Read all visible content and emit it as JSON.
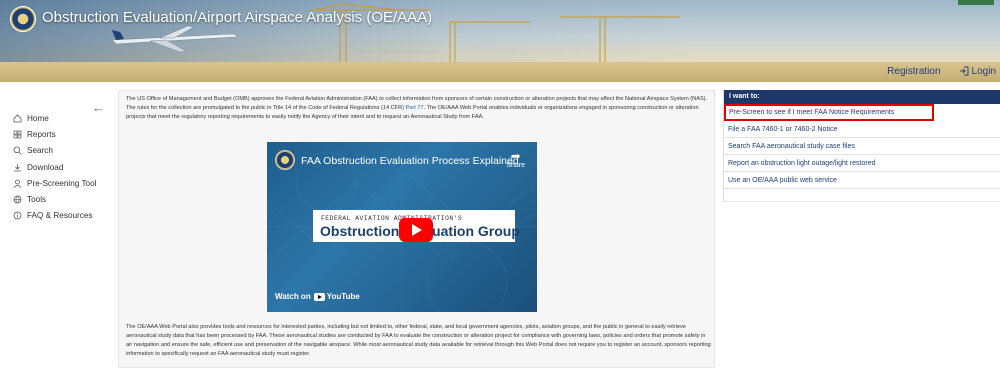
{
  "header": {
    "title": "Obstruction Evaluation/Airport Airspace Analysis (OE/AAA)",
    "links": {
      "registration": "Registration",
      "login": "Login"
    },
    "icons": {
      "seal": "faa-seal-icon",
      "login": "login-icon"
    }
  },
  "sidebar": {
    "items": [
      {
        "label": "Home",
        "icon": "home-icon"
      },
      {
        "label": "Reports",
        "icon": "reports-icon"
      },
      {
        "label": "Search",
        "icon": "search-icon"
      },
      {
        "label": "Download",
        "icon": "download-icon"
      },
      {
        "label": "Pre-Screening Tool",
        "icon": "person-icon"
      },
      {
        "label": "Tools",
        "icon": "globe-icon"
      },
      {
        "label": "FAQ & Resources",
        "icon": "info-icon"
      }
    ]
  },
  "main": {
    "intro_part1": "The US Office of Management and Budget (OMB) approves the Federal Aviation Administration (FAA) to collect information from sponsors of certain construction or alteration projects that may affect the National Airspace System (NAS). The rules for the collection are promulgated to the public in Title 14 of the Code of Federal Regulations (14 CFR) ",
    "intro_link": "Part 77",
    "intro_part2": ". The OE/AAA Web Portal enables individuals or organizations engaged in sponsoring construction or alteration projects that meet the regulatory reporting requirements to easily notify the Agency of their intent and to request an Aeronautical Study from FAA.",
    "video": {
      "title": "FAA Obstruction Evaluation Process Explained",
      "share": "Share",
      "card_sub": "FEDERAL AVIATION ADMINISTRATION'S",
      "card_main": "Obstruction Evaluation Group",
      "watch_on": "Watch on",
      "youtube": "YouTube"
    },
    "outro": "The OE/AAA Web Portal also provides tools and resources for interested parties, including but not limited to, other federal, state, and local government agencies, pilots, aviation groups, and the public in general to easily retrieve aeronautical study data that has been processed by FAA. These aeronautical studies are conducted by FAA to evaluate the construction or alteration project for compliance with governing laws, policies and orders that promote safety in air navigation and ensure the safe, efficient use and preservation of the navigable airspace. While most aeronautical study data available for retrieval through this Web Portal does not require you to register an account, sponsors reporting information to specifically request an FAA aeronautical study must register."
  },
  "panel": {
    "heading": "I want to:",
    "items": [
      "Pre-Screen to see if I meet FAA Notice Requirements",
      "File a FAA 7460-1 or 7460-2 Notice",
      "Search FAA aeronautical study case files",
      "Report an obstruction light outage/light restored",
      "Use an OE/AAA public web service"
    ]
  },
  "colors": {
    "navy": "#1c3768",
    "link": "#1f3f78",
    "highlight": "#e00000",
    "youtube_red": "#ff0000"
  }
}
